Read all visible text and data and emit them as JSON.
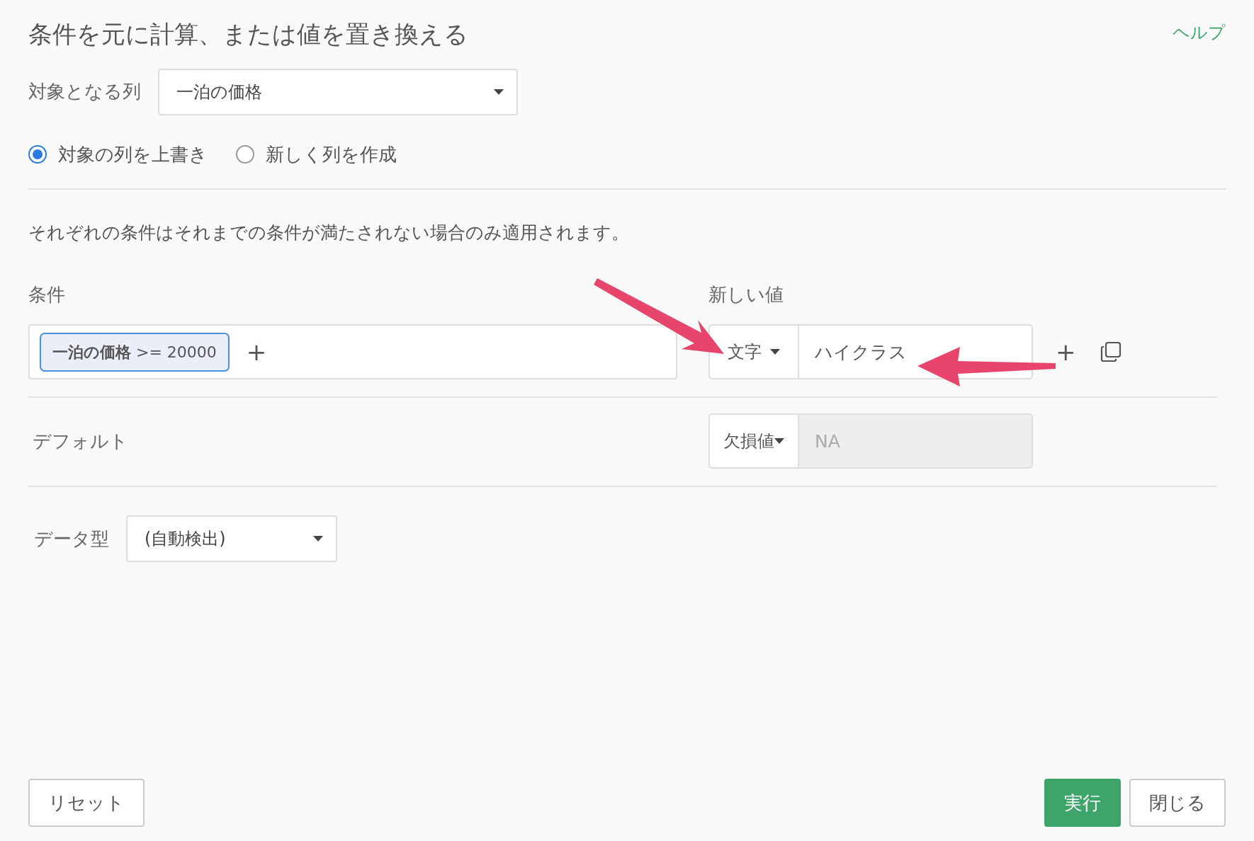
{
  "title": "条件を元に計算、または値を置き換える",
  "help_link": "ヘルプ",
  "target_column": {
    "label": "対象となる列",
    "value": "一泊の価格"
  },
  "output_mode": [
    {
      "label": "対象の列を上書き",
      "selected": true
    },
    {
      "label": "新しく列を作成",
      "selected": false
    }
  ],
  "description": "それぞれの条件はそれまでの条件が満たされない場合のみ適用されます。",
  "conditions_header": "条件",
  "new_value_header": "新しい値",
  "rules": [
    {
      "condition": "**一泊の価格** >= 20000",
      "add_symbol": "+",
      "value_type": "文字",
      "value": "ハイクラス"
    }
  ],
  "default": {
    "label": "デフォルト",
    "value_type": "欠損値",
    "placeholder": "NA",
    "disabled": true
  },
  "data_type": {
    "label": "データ型",
    "value": "(自動検出)"
  },
  "buttons": {
    "reset": "リセット",
    "run": "実行",
    "close": "閉じる"
  }
}
